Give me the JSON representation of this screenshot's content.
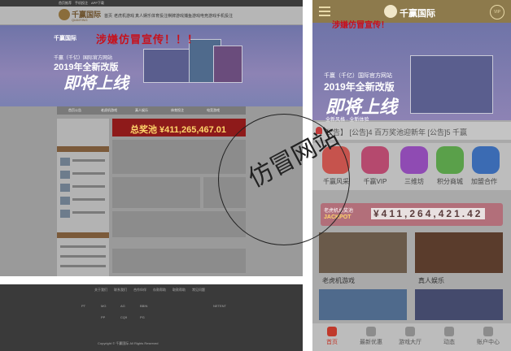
{
  "desktop": {
    "topbar": [
      "首页推荐",
      "手机投注",
      "APP下载",
      "在线客服"
    ],
    "brand": "千赢国际",
    "brand_sub": "QIANYING",
    "nav": [
      "首页",
      "老虎机游戏",
      "真人娱乐",
      "体育投注",
      "棋牌游戏",
      "捕鱼游戏",
      "电竞游戏",
      "手机投注",
      "优惠活动"
    ],
    "hero_brand": "千赢国际",
    "hero_sub": "千赢（千亿）国际官方网站",
    "hero_year": "2019年全新改版",
    "hero_big": "即将上线",
    "warning": "涉嫌仿冒宣传！！！",
    "subnav": [
      "首页公告",
      "老虎机游戏",
      "真人娱乐",
      "体育投注",
      "电竞游戏"
    ],
    "jackpot": "总奖池 ¥411,265,467.01"
  },
  "footer": {
    "links": [
      "关于我们",
      "联系我们",
      "合作伙伴",
      "存款帮助",
      "取款帮助",
      "常见问题"
    ],
    "providers": [
      "PT",
      "MG",
      "AG",
      "BBIN",
      "NETENT",
      "PP",
      "CQ9",
      "PG"
    ],
    "copyright": "Copyright © 千赢国际 All Rights Reserved"
  },
  "mobile": {
    "brand": "千赢国际",
    "vip_label": "VIP",
    "hero_line1": "千赢（千亿）国际官方网站",
    "hero_line2": "2019年全新改版",
    "hero_big": "即将上线",
    "hero_tags": "全新风格 · 全新体验",
    "warning": "涉嫌仿冒宣传！",
    "notice": "公告】 [公告]4 百万奖池迎新年 [公告]5 千赢",
    "icons": [
      {
        "label": "千赢风采",
        "color": "#c6534d"
      },
      {
        "label": "千赢VIP",
        "color": "#b5496e"
      },
      {
        "label": "三维坊",
        "color": "#8f4bb3"
      },
      {
        "label": "积分商城",
        "color": "#5aa04a"
      },
      {
        "label": "加盟合作",
        "color": "#3b6bb3"
      }
    ],
    "jackpot_label": "老虎机总奖池",
    "jackpot_tag": "JACKPOT",
    "jackpot_value": "¥411,264,421.42",
    "games": [
      "老虎机游戏",
      "真人娱乐"
    ],
    "tabs": [
      "首页",
      "最新优惠",
      "游戏大厅",
      "动态",
      "账户中心"
    ],
    "active_tab": 0
  },
  "stamp": "仿冒网站"
}
